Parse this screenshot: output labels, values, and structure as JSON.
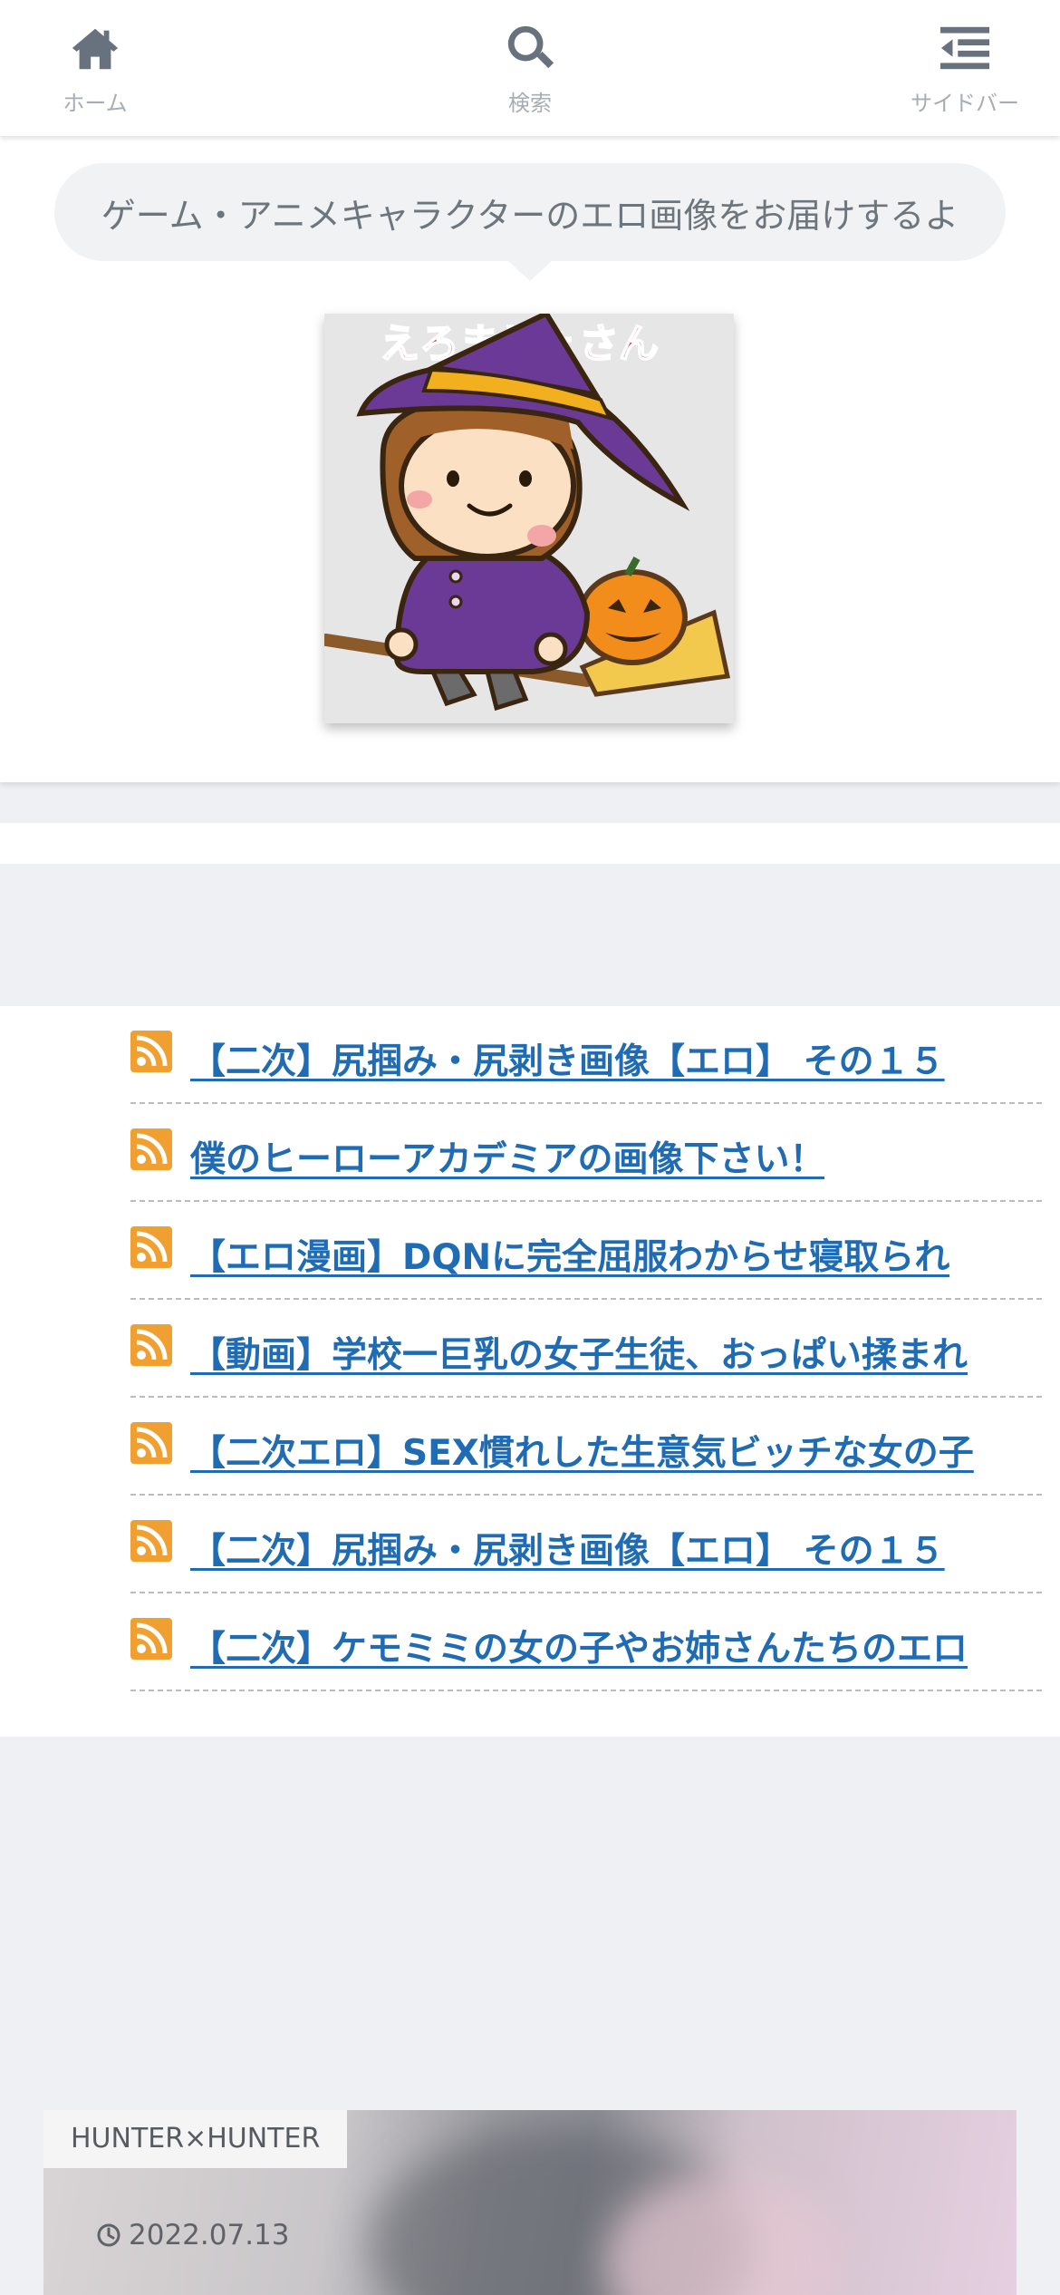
{
  "nav": {
    "home_label": "ホーム",
    "search_label": "検索",
    "sidebar_label": "サイドバー"
  },
  "header": {
    "tagline": "ゲーム・アニメキャラクターのエロ画像をお届けするよ",
    "logo_text": "えろまじょさん"
  },
  "rss": {
    "items": [
      {
        "title": "【二次】尻掴み・尻剥き画像【エロ】 その１５"
      },
      {
        "title": "僕のヒーローアカデミアの画像下さい！"
      },
      {
        "title": "【エロ漫画】DQNに完全屈服わからせ寝取られ"
      },
      {
        "title": "【動画】学校一巨乳の女子生徒、おっぱい揉まれ"
      },
      {
        "title": "【二次エロ】SEX慣れした生意気ビッチな女の子"
      },
      {
        "title": "【二次】尻掴み・尻剥き画像【エロ】 その１５"
      },
      {
        "title": "【二次】ケモミミの女の子やお姉さんたちのエロ"
      }
    ]
  },
  "card": {
    "category": "HUNTER×HUNTER",
    "date": "2022.07.13"
  },
  "colors": {
    "link": "#1f6bb4",
    "nav_icon": "#67727e",
    "page_bg": "#eef0f3"
  },
  "icons": [
    "home-icon",
    "search-icon",
    "sidebar-icon",
    "rss-icon",
    "clock-icon"
  ]
}
